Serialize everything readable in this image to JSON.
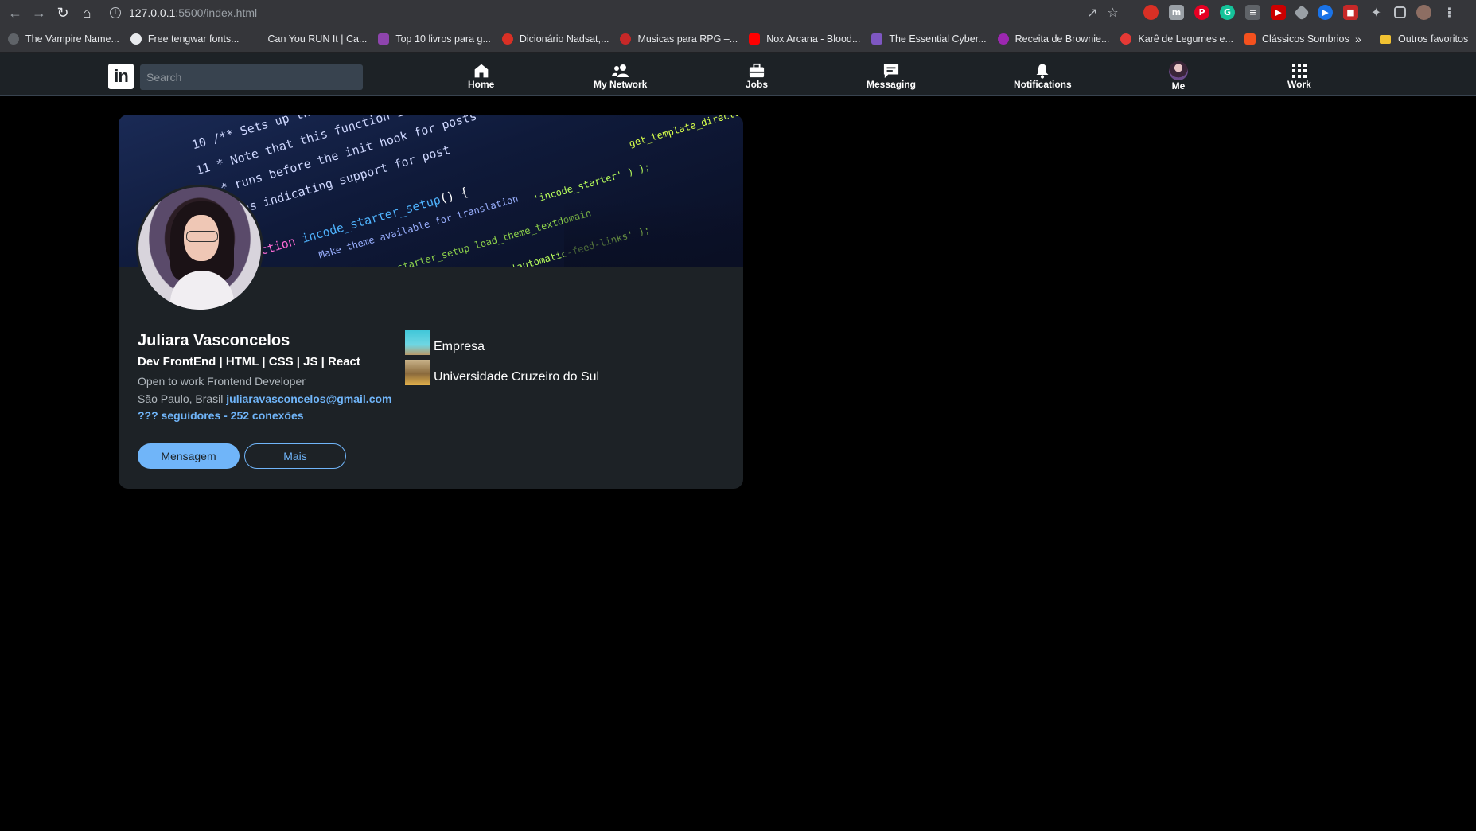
{
  "browser": {
    "url_host": "127.0.0.1",
    "url_path": ":5500/index.html",
    "bookmarks": [
      {
        "label": "The Vampire Name...",
        "color": "#5f6368"
      },
      {
        "label": "Free tengwar fonts...",
        "color": "#202124"
      },
      {
        "label": "Can You RUN It | Ca...",
        "color": "#35363a"
      },
      {
        "label": "Top 10 livros para g...",
        "color": "#8e44ad"
      },
      {
        "label": "Dicionário Nadsat,...",
        "color": "#d93025"
      },
      {
        "label": "Musicas para RPG –...",
        "color": "#c62828"
      },
      {
        "label": "Nox Arcana - Blood...",
        "color": "#ff0000"
      },
      {
        "label": "The Essential Cyber...",
        "color": "#7e57c2"
      },
      {
        "label": "Receita de Brownie...",
        "color": "#9c27b0"
      },
      {
        "label": "Karê de Legumes e...",
        "color": "#e53935"
      },
      {
        "label": "Clássicos Sombrios",
        "color": "#f4511e"
      }
    ],
    "bookmarks_more": "»",
    "other_bookmarks": "Outros favoritos"
  },
  "linkedin": {
    "logo": "in",
    "search_placeholder": "Search",
    "nav": [
      {
        "label": "Home",
        "icon": "home-icon"
      },
      {
        "label": "My Network",
        "icon": "network-icon"
      },
      {
        "label": "Jobs",
        "icon": "briefcase-icon"
      },
      {
        "label": "Messaging",
        "icon": "messaging-icon"
      },
      {
        "label": "Notifications",
        "icon": "bell-icon"
      },
      {
        "label": "Me",
        "icon": "avatar"
      },
      {
        "label": "Work",
        "icon": "grid-icon"
      }
    ]
  },
  "profile": {
    "name": "Juliara Vasconcelos",
    "headline": "Dev FrontEnd | HTML | CSS | JS | React",
    "subtitle": "Open to work Frontend Developer",
    "location": "São Paulo, Brasil",
    "email": "juliaravasconcelos@gmail.com",
    "connections": "??? seguidores - 252 conexões",
    "message_button": "Mensagem",
    "more_button": "Mais",
    "company": "Empresa",
    "education": "Universidade Cruzeiro do Sul"
  },
  "colors": {
    "accent": "#70b5f9",
    "header_bg": "#1d2226",
    "card_bg": "#1d2226"
  }
}
